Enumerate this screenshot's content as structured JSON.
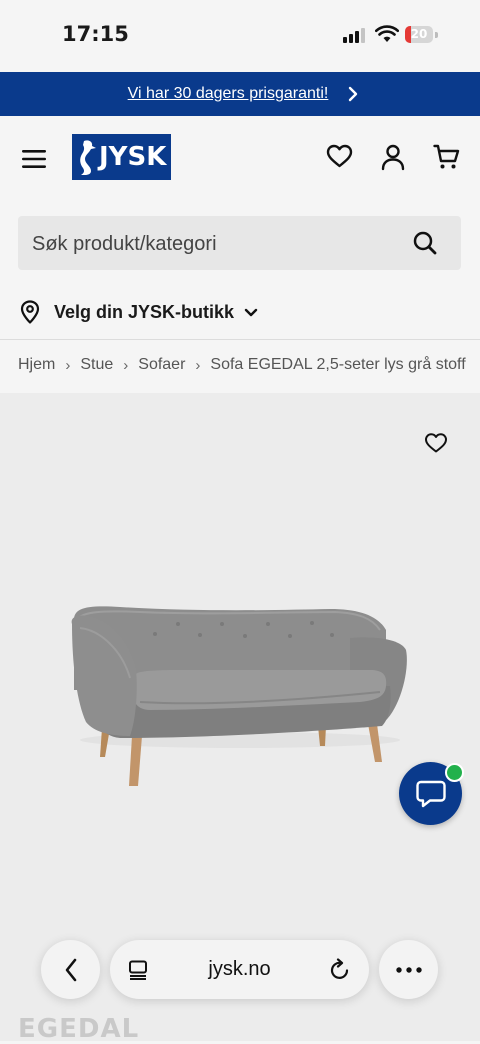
{
  "status_bar": {
    "time": "17:15",
    "battery": "20",
    "battery_level": 0.2
  },
  "promo": {
    "text": "Vi har 30 dagers prisgaranti!"
  },
  "header": {
    "logo": "JYSK"
  },
  "search": {
    "placeholder": "Søk produkt/kategori"
  },
  "store_selector": {
    "label": "Velg din JYSK-butikk"
  },
  "breadcrumb": [
    "Hjem",
    "Stue",
    "Sofaer",
    "Sofa EGEDAL 2,5-seter lys grå stoff"
  ],
  "product": {
    "name_partial": "EGEDAL"
  },
  "browser": {
    "url": "jysk.no"
  },
  "colors": {
    "brand_blue": "#0a3a8c",
    "chat_online": "#22b14c",
    "battery_low": "#e53935"
  }
}
